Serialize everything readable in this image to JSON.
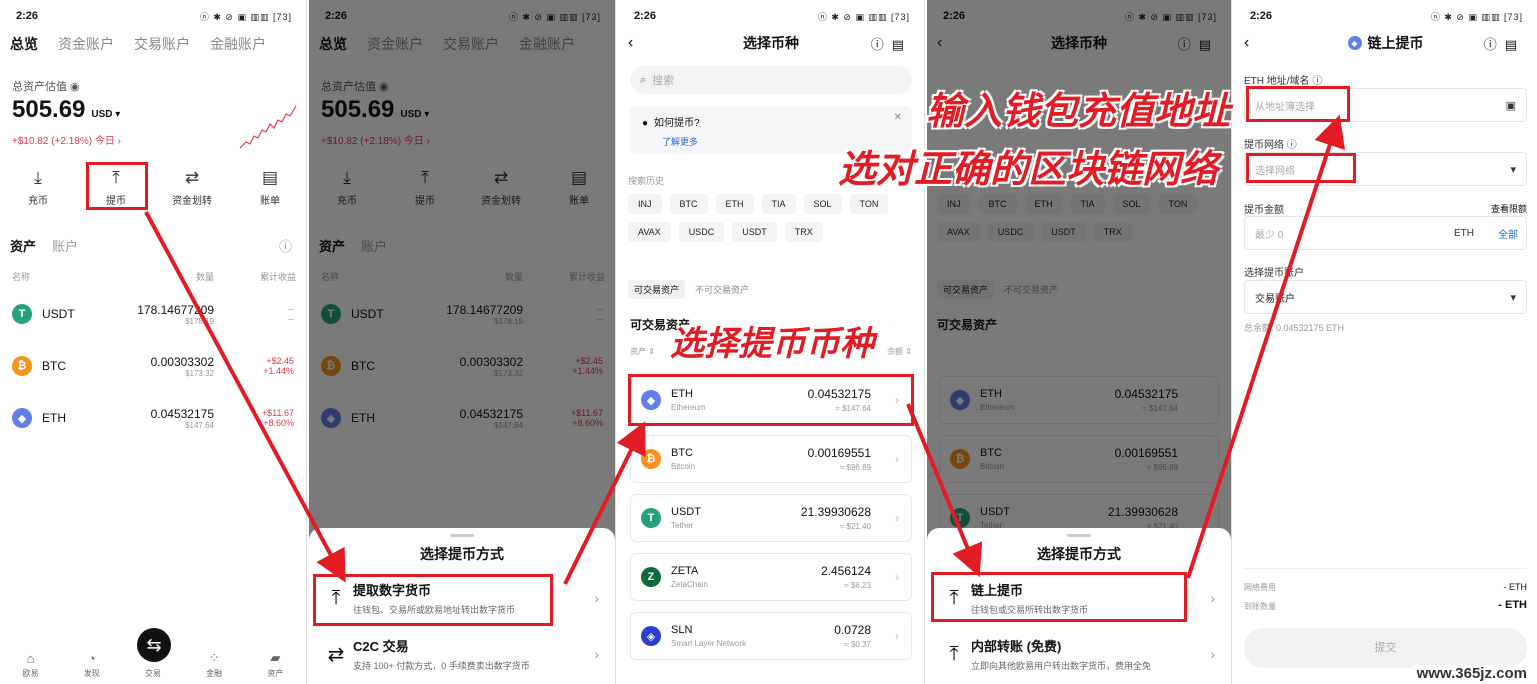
{
  "status": {
    "time": "2:26",
    "icons": "ⓝ ✱ ⊘ ▣ ▥▥ [73]"
  },
  "wallet": {
    "tabs": [
      "总览",
      "资金账户",
      "交易账户",
      "金融账户"
    ],
    "est_label": "总资产估值 ◉",
    "balance": "505.69",
    "currency": "USD ▾",
    "change": "+$10.82 (+2.18%) 今日 ›",
    "actions": [
      {
        "icon": "⤓",
        "label": "充币"
      },
      {
        "icon": "⤒",
        "label": "提币"
      },
      {
        "icon": "⇄",
        "label": "资金划转"
      },
      {
        "icon": "▤",
        "label": "账单"
      }
    ],
    "section_tabs": [
      "资产",
      "账户"
    ],
    "col_name": "名称",
    "col_qty": "数量",
    "col_pnl": "累计收益",
    "assets": [
      {
        "sym": "USDT",
        "glyph": "T",
        "cls": "c-usdt",
        "qty": "178.14677209",
        "fiat": "$178.19",
        "pnl": "--",
        "pct": "--",
        "color": "gray"
      },
      {
        "sym": "BTC",
        "glyph": "₿",
        "cls": "c-btc",
        "qty": "0.00303302",
        "fiat": "$173.32",
        "pnl": "+$2.45",
        "pct": "+1.44%",
        "color": "red"
      },
      {
        "sym": "ETH",
        "glyph": "◆",
        "cls": "c-eth",
        "qty": "0.04532175",
        "fiat": "$147.64",
        "pnl": "+$11.67",
        "pct": "+8.60%",
        "color": "red"
      }
    ],
    "bottom_tabs": [
      {
        "icon": "⌂",
        "label": "欧易"
      },
      {
        "icon": "◔",
        "label": "发现"
      },
      {
        "icon": "",
        "label": "交易"
      },
      {
        "icon": "⁘",
        "label": "金融"
      },
      {
        "icon": "▰",
        "label": "资产"
      }
    ],
    "swap_icon": "⇆"
  },
  "sheet1": {
    "title": "选择提币方式",
    "options": [
      {
        "icon": "⤒",
        "title": "提取数字货币",
        "desc": "往钱包、交易所或欧易地址转出数字货币"
      },
      {
        "icon": "⇄",
        "title": "C2C 交易",
        "desc": "支持 100+ 付款方式，0 手续费卖出数字货币"
      }
    ]
  },
  "picker": {
    "title": "选择币种",
    "search_placeholder": "搜索",
    "tip_title": "如何提币?",
    "tip_more": "了解更多",
    "history_label": "搜索历史",
    "history": [
      "INJ",
      "BTC",
      "ETH",
      "TIA",
      "SOL",
      "TON",
      "AVAX",
      "USDC",
      "USDT",
      "TRX"
    ],
    "tabs": [
      "可交易资产",
      "不可交易资产"
    ],
    "section": "可交易资产",
    "col_asset": "资产 ⇕",
    "col_balance": "余额 ⇕",
    "coins": [
      {
        "sym": "ETH",
        "name": "Ethereum",
        "glyph": "◆",
        "cls": "c-eth",
        "amt": "0.04532175",
        "fiat": "≈ $147.64"
      },
      {
        "sym": "BTC",
        "name": "Bitcoin",
        "glyph": "₿",
        "cls": "c-btc",
        "amt": "0.00169551",
        "fiat": "≈ $96.89"
      },
      {
        "sym": "USDT",
        "name": "Tether",
        "glyph": "T",
        "cls": "c-usdt",
        "amt": "21.39930628",
        "fiat": "≈ $21.40"
      },
      {
        "sym": "ZETA",
        "name": "ZetaChain",
        "glyph": "Z",
        "cls": "c-zeta",
        "amt": "2.456124",
        "fiat": "≈ $6.23"
      },
      {
        "sym": "SLN",
        "name": "Smart Layer Network",
        "glyph": "◈",
        "cls": "c-sln",
        "amt": "0.0728",
        "fiat": "≈ $0.37"
      }
    ]
  },
  "sheet2": {
    "title": "选择提币方式",
    "options": [
      {
        "icon": "⤒",
        "title": "链上提币",
        "desc": "往钱包或交易所转出数字货币"
      },
      {
        "icon": "⤒",
        "title": "内部转账 (免费)",
        "desc": "立即向其他欧易用户转出数字货币，费用全免"
      }
    ]
  },
  "form": {
    "title": "链上提币",
    "address_label": "ETH 地址/域名 ⓘ",
    "address_placeholder": "从地址簿选择",
    "network_label": "提币网络 ⓘ",
    "network_placeholder": "选择网络",
    "amount_label": "提币金额",
    "limit_link": "查看限额",
    "amount_placeholder": "最少 0",
    "amount_unit": "ETH",
    "amount_all": "全部",
    "account_label": "选择提币账户",
    "account_value": "交易账户",
    "total": "总余额: 0.04532175 ETH",
    "fee_label": "网络费用",
    "fee_value": "- ETH",
    "receive_label": "到账数量",
    "receive_value": "- ETH",
    "submit": "提交"
  },
  "captions": {
    "c1": "选择提币币种",
    "c2": "输入钱包充值地址",
    "c3": "选对正确的区块链网络"
  },
  "watermark": "www.365jz.com"
}
